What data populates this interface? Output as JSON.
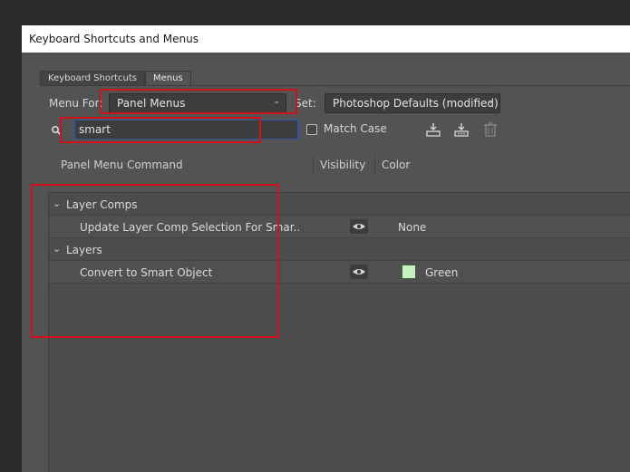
{
  "window": {
    "title": "Keyboard Shortcuts and Menus"
  },
  "tabs": [
    {
      "label": "Keyboard Shortcuts",
      "active": false
    },
    {
      "label": "Menus",
      "active": true
    }
  ],
  "menu_for": {
    "label": "Menu For:",
    "value": "Panel Menus"
  },
  "set": {
    "label": "Set:",
    "value": "Photoshop Defaults (modified)"
  },
  "search": {
    "value": "smart",
    "icon": "search-icon"
  },
  "match_case": {
    "label": "Match Case",
    "checked": false
  },
  "toolbar_icons": [
    "save-set-icon",
    "save-set-as-icon",
    "delete-set-icon"
  ],
  "columns": {
    "command": "Panel Menu Command",
    "visibility": "Visibility",
    "color": "Color"
  },
  "rows": [
    {
      "type": "group",
      "label": "Layer Comps",
      "expanded": true
    },
    {
      "type": "item",
      "label": "Update Layer Comp Selection For Smar..",
      "visible": true,
      "color": "None",
      "swatch": null
    },
    {
      "type": "group",
      "label": "Layers",
      "expanded": true
    },
    {
      "type": "item",
      "label": "Convert to Smart Object",
      "visible": true,
      "color": "Green",
      "swatch": "#c7f3c1"
    }
  ],
  "colors": {
    "highlight": "#d0121c",
    "focus_border": "#2c58a0"
  }
}
